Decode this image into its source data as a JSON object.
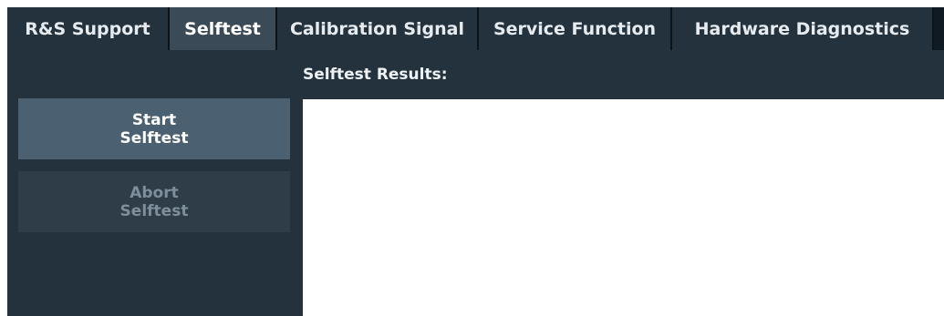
{
  "tabs": [
    {
      "label": "R&S Support",
      "active": false
    },
    {
      "label": "Selftest",
      "active": true
    },
    {
      "label": "Calibration Signal",
      "active": false
    },
    {
      "label": "Service Function",
      "active": false
    },
    {
      "label": "Hardware Diagnostics",
      "active": false
    }
  ],
  "selftest": {
    "results_label": "Selftest Results:",
    "start_label": "Start\nSelftest",
    "abort_label": "Abort\nSelftest",
    "abort_enabled": false
  },
  "colors": {
    "panel_bg": "#24323d",
    "active_tab": "#3a4a57",
    "button_bg": "#4b6070",
    "disabled_button_bg": "#2e3d48",
    "results_bg": "#ffffff"
  }
}
